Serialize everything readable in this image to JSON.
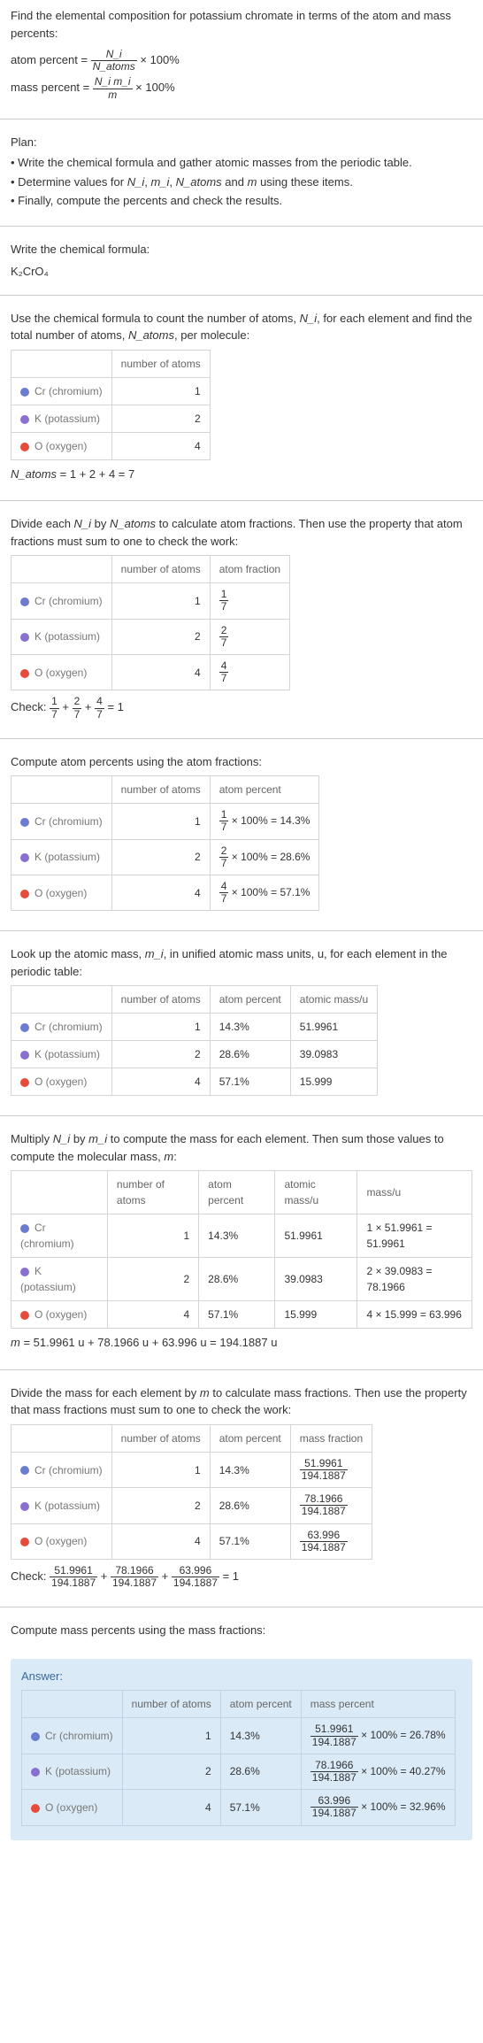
{
  "intro": {
    "title": "Find the elemental composition for potassium chromate in terms of the atom and mass percents:",
    "atom_percent_label": "atom percent = ",
    "atom_percent_num": "N_i",
    "atom_percent_den": "N_atoms",
    "times100a": " × 100%",
    "mass_percent_label": "mass percent = ",
    "mass_percent_num": "N_i m_i",
    "mass_percent_den": "m",
    "times100b": " × 100%"
  },
  "plan": {
    "head": "Plan:",
    "item1": "• Write the chemical formula and gather atomic masses from the periodic table.",
    "item2p1": "• Determine values for ",
    "ni": "N_i",
    "mi": "m_i",
    "natoms": "N_atoms",
    "m": "m",
    "item2p2": ", ",
    "item2p3": ", ",
    "item2p4": " and ",
    "item2p5": " using these items.",
    "item3": "• Finally, compute the percents and check the results."
  },
  "formula": {
    "head": "Write the chemical formula:",
    "text": "K₂CrO₄"
  },
  "count": {
    "head_p1": "Use the chemical formula to count the number of atoms, ",
    "ni": "N_i",
    "head_p2": ", for each element and find the total number of atoms, ",
    "natoms": "N_atoms",
    "head_p3": ", per molecule:",
    "col_atoms": "number of atoms",
    "cr_label": "Cr (chromium)",
    "cr_n": "1",
    "k_label": "K (potassium)",
    "k_n": "2",
    "o_label": "O (oxygen)",
    "o_n": "4",
    "sum_lhs": "N_atoms",
    "sum_rhs": " = 1 + 2 + 4 = 7"
  },
  "atomfrac": {
    "head_p1": "Divide each ",
    "ni": "N_i",
    "head_p2": " by ",
    "natoms": "N_atoms",
    "head_p3": " to calculate atom fractions. Then use the property that atom fractions must sum to one to check the work:",
    "col_atoms": "number of atoms",
    "col_frac": "atom fraction",
    "cr_n": "1",
    "cr_num": "1",
    "cr_den": "7",
    "k_n": "2",
    "k_num": "2",
    "k_den": "7",
    "o_n": "4",
    "o_num": "4",
    "o_den": "7",
    "check_label": "Check: ",
    "c1n": "1",
    "c1d": "7",
    "plus1": " + ",
    "c2n": "2",
    "c2d": "7",
    "plus2": " + ",
    "c3n": "4",
    "c3d": "7",
    "eq1": " = 1"
  },
  "atompct": {
    "head": "Compute atom percents using the atom fractions:",
    "col_atoms": "number of atoms",
    "col_pct": "atom percent",
    "cr_n": "1",
    "cr_num": "1",
    "cr_den": "7",
    "cr_rest": " × 100% = 14.3%",
    "k_n": "2",
    "k_num": "2",
    "k_den": "7",
    "k_rest": " × 100% = 28.6%",
    "o_n": "4",
    "o_num": "4",
    "o_den": "7",
    "o_rest": " × 100% = 57.1%"
  },
  "atmass": {
    "head_p1": "Look up the atomic mass, ",
    "mi": "m_i",
    "head_p2": ", in unified atomic mass units, u, for each element in the periodic table:",
    "col_atoms": "number of atoms",
    "col_pct": "atom percent",
    "col_mass": "atomic mass/u",
    "cr_n": "1",
    "cr_p": "14.3%",
    "cr_m": "51.9961",
    "k_n": "2",
    "k_p": "28.6%",
    "k_m": "39.0983",
    "o_n": "4",
    "o_p": "57.1%",
    "o_m": "15.999"
  },
  "multiply": {
    "head_p1": "Multiply ",
    "ni": "N_i",
    "by": " by ",
    "mi": "m_i",
    "head_p2": " to compute the mass for each element. Then sum those values to compute the molecular mass, ",
    "m": "m",
    "head_p3": ":",
    "col_atoms": "number of atoms",
    "col_pct": "atom percent",
    "col_amass": "atomic mass/u",
    "col_mass": "mass/u",
    "cr_n": "1",
    "cr_p": "14.3%",
    "cr_am": "51.9961",
    "cr_mu": "1 × 51.9961 = 51.9961",
    "k_n": "2",
    "k_p": "28.6%",
    "k_am": "39.0983",
    "k_mu": "2 × 39.0983 = 78.1966",
    "o_n": "4",
    "o_p": "57.1%",
    "o_am": "15.999",
    "o_mu": "4 × 15.999 = 63.996",
    "sum_m": "m",
    "sum_rest": " = 51.9961 u + 78.1966 u + 63.996 u = 194.1887 u"
  },
  "massfrac": {
    "head_p1": "Divide the mass for each element by ",
    "m": "m",
    "head_p2": " to calculate mass fractions. Then use the property that mass fractions must sum to one to check the work:",
    "col_atoms": "number of atoms",
    "col_pct": "atom percent",
    "col_mf": "mass fraction",
    "cr_n": "1",
    "cr_p": "14.3%",
    "cr_num": "51.9961",
    "cr_den": "194.1887",
    "k_n": "2",
    "k_p": "28.6%",
    "k_num": "78.1966",
    "k_den": "194.1887",
    "o_n": "4",
    "o_p": "57.1%",
    "o_num": "63.996",
    "o_den": "194.1887",
    "check_label": "Check: ",
    "c1n": "51.9961",
    "c1d": "194.1887",
    "plus1": " + ",
    "c2n": "78.1966",
    "c2d": "194.1887",
    "plus2": " + ",
    "c3n": "63.996",
    "c3d": "194.1887",
    "eq1": " = 1"
  },
  "masspct": {
    "head": "Compute mass percents using the mass fractions:"
  },
  "answer": {
    "label": "Answer:",
    "col_atoms": "number of atoms",
    "col_pct": "atom percent",
    "col_mpct": "mass percent",
    "cr_n": "1",
    "cr_p": "14.3%",
    "cr_num": "51.9961",
    "cr_den": "194.1887",
    "cr_rest": " × 100% = 26.78%",
    "k_n": "2",
    "k_p": "28.6%",
    "k_num": "78.1966",
    "k_den": "194.1887",
    "k_rest": " × 100% = 40.27%",
    "o_n": "4",
    "o_p": "57.1%",
    "o_num": "63.996",
    "o_den": "194.1887",
    "o_rest": " × 100% = 32.96%"
  },
  "colors": {
    "cr": "#6a7dd0",
    "k": "#8a6fd3",
    "o": "#e84b3a"
  }
}
